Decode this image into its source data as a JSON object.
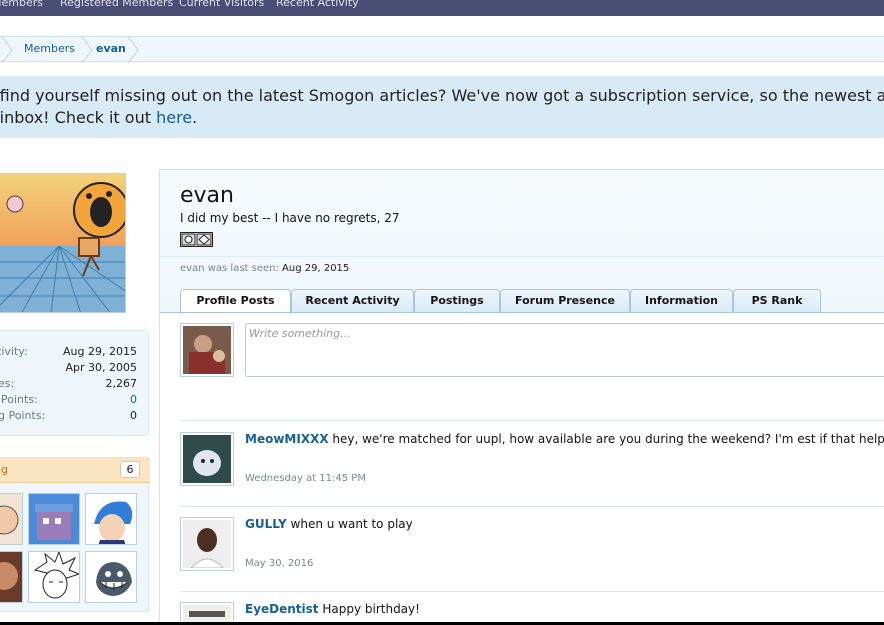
{
  "topnav": {
    "items": [
      "Members",
      "Registered Members",
      "Current Visitors",
      "Recent Activity"
    ]
  },
  "breadcrumb": {
    "items": [
      "Members",
      "evan"
    ]
  },
  "notice": {
    "line1": "r find yourself missing out on the latest Smogon articles? We've now got a subscription service, so the newest article",
    "line2_prefix": "r inbox! Check it out ",
    "line2_link": "here",
    "line2_suffix": "."
  },
  "sidebar": {
    "stats": [
      {
        "label": "ctivity:",
        "value": "Aug 29, 2015"
      },
      {
        "label": "l:",
        "value": "Apr 30, 2005"
      },
      {
        "label": "ges:",
        "value": "2,267"
      },
      {
        "label": "y Points:",
        "value": "0"
      },
      {
        "label": "ng Points:",
        "value": "0"
      }
    ],
    "following": {
      "title": "ing",
      "count": "6"
    }
  },
  "profile": {
    "username": "evan",
    "user_title": "I did my best -- I have no regrets, 27",
    "last_seen_label": "evan was last seen:",
    "last_seen_value": "Aug 29, 2015"
  },
  "tabs": [
    "Profile Posts",
    "Recent Activity",
    "Postings",
    "Forum Presence",
    "Information",
    "PS Rank"
  ],
  "status_box": {
    "placeholder": "Write something..."
  },
  "posts": [
    {
      "author": "MeowMIXXX",
      "text": " hey, we're matched for uupl, how available are you during the weekend? I'm est if that helps",
      "date": "Wednesday at 11:45 PM"
    },
    {
      "author": "GULLY",
      "text": " when u want to play",
      "date": "May 30, 2016"
    },
    {
      "author": "EyeDentist",
      "text": " Happy birthday!",
      "date": ""
    }
  ],
  "colors": {
    "nav_bg": "#4a4d74",
    "link": "#176093",
    "notice_bg": "#d7eaf6",
    "panel_bg": "#f0f7fc",
    "following_head_bg": "#fbe4c1"
  }
}
